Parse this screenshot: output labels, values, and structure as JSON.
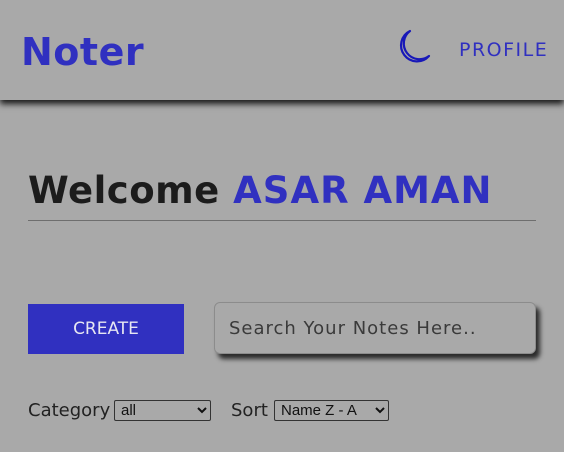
{
  "navbar": {
    "brand": "Noter",
    "theme_icon": "moon-icon",
    "profile_label": "PROFILE"
  },
  "welcome": {
    "greeting": "Welcome",
    "user_name": "ASAR AMAN"
  },
  "actions": {
    "create_label": "CREATE",
    "search_placeholder": "Search Your Notes Here..",
    "search_value": ""
  },
  "filters": {
    "category_label": "Category",
    "category_selected": "all",
    "sort_label": "Sort",
    "sort_selected": "Name Z - A"
  },
  "colors": {
    "background": "#a9a9a9",
    "accent": "#3030c0",
    "text": "#1c1c1c"
  }
}
